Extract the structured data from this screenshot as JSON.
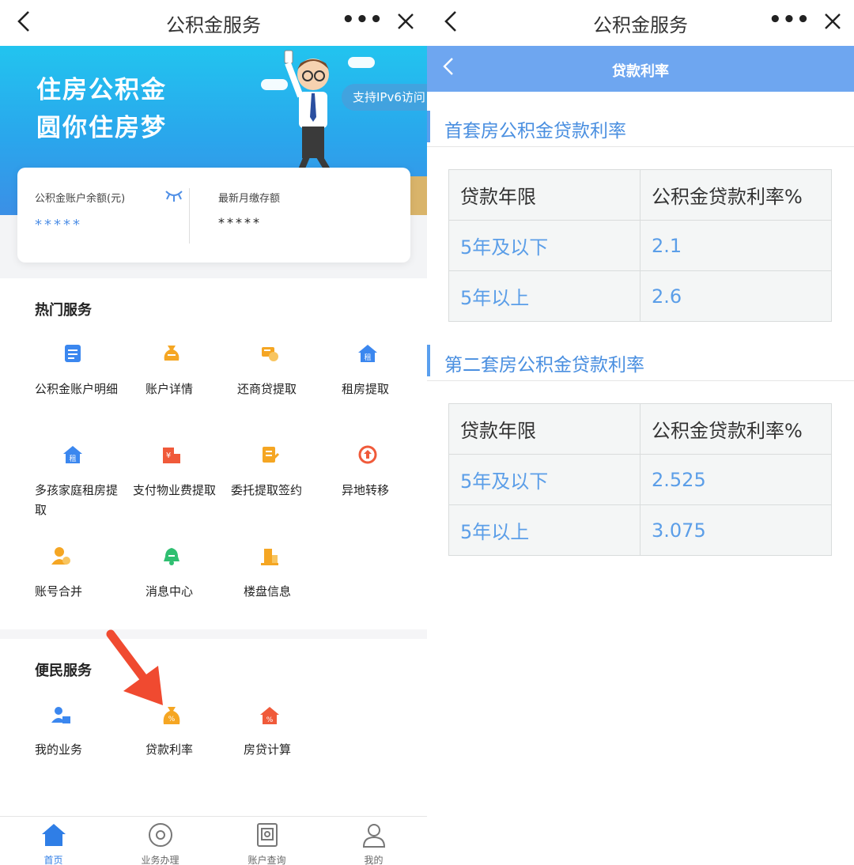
{
  "left": {
    "nav": {
      "title": "公积金服务",
      "more": "•••"
    },
    "banner": {
      "line1": "住房公积金",
      "line2": "圆你住房梦",
      "ipv6": "支持IPv6访问"
    },
    "balance": {
      "label_balance": "公积金账户余额(元)",
      "value_balance": "*****",
      "label_deposit": "最新月缴存额",
      "value_deposit": "*****"
    },
    "hot": {
      "title": "热门服务",
      "items": [
        {
          "label": "公积金账户明细",
          "icon": "document-list-icon",
          "color": "#3b87ef"
        },
        {
          "label": "账户详情",
          "icon": "money-bag-icon",
          "color": "#f5a623"
        },
        {
          "label": "还商贷提取",
          "icon": "loan-repay-icon",
          "color": "#f5a623"
        },
        {
          "label": "租房提取",
          "icon": "rent-house-icon",
          "color": "#3b87ef"
        },
        {
          "label": "多孩家庭租房提取",
          "icon": "rent-house-icon",
          "color": "#3b87ef"
        },
        {
          "label": "支付物业费提取",
          "icon": "property-fee-icon",
          "color": "#f05a3a"
        },
        {
          "label": "委托提取签约",
          "icon": "contract-icon",
          "color": "#f5a623"
        },
        {
          "label": "异地转移",
          "icon": "transfer-icon",
          "color": "#f05a3a"
        },
        {
          "label": "账号合并",
          "icon": "user-merge-icon",
          "color": "#f5a623"
        },
        {
          "label": "消息中心",
          "icon": "bell-icon",
          "color": "#2fbf71"
        },
        {
          "label": "楼盘信息",
          "icon": "building-icon",
          "color": "#f5a623"
        }
      ]
    },
    "convenience": {
      "title": "便民服务",
      "items": [
        {
          "label": "我的业务",
          "icon": "user-business-icon",
          "color": "#3b87ef"
        },
        {
          "label": "贷款利率",
          "icon": "rate-bag-icon",
          "color": "#f5a623"
        },
        {
          "label": "房贷计算",
          "icon": "house-calc-icon",
          "color": "#f05a3a"
        }
      ]
    },
    "tabs": [
      {
        "label": "首页",
        "icon": "home-icon",
        "active": true
      },
      {
        "label": "业务办理",
        "icon": "business-icon",
        "active": false
      },
      {
        "label": "账户查询",
        "icon": "account-query-icon",
        "active": false
      },
      {
        "label": "我的",
        "icon": "profile-icon",
        "active": false
      }
    ]
  },
  "right": {
    "nav": {
      "title": "公积金服务",
      "more": "•••"
    },
    "header_title": "贷款利率",
    "sections": [
      {
        "title": "首套房公积金贷款利率",
        "columns": [
          "贷款年限",
          "公积金贷款利率%"
        ],
        "rows": [
          [
            "5年及以下",
            "2.1"
          ],
          [
            "5年以上",
            "2.6"
          ]
        ]
      },
      {
        "title": "第二套房公积金贷款利率",
        "columns": [
          "贷款年限",
          "公积金贷款利率%"
        ],
        "rows": [
          [
            "5年及以下",
            "2.525"
          ],
          [
            "5年以上",
            "3.075"
          ]
        ]
      }
    ]
  },
  "colors": {
    "accent": "#4a8fe0",
    "header_bg": "#6ea6f0",
    "arrow": "#f04a30"
  }
}
